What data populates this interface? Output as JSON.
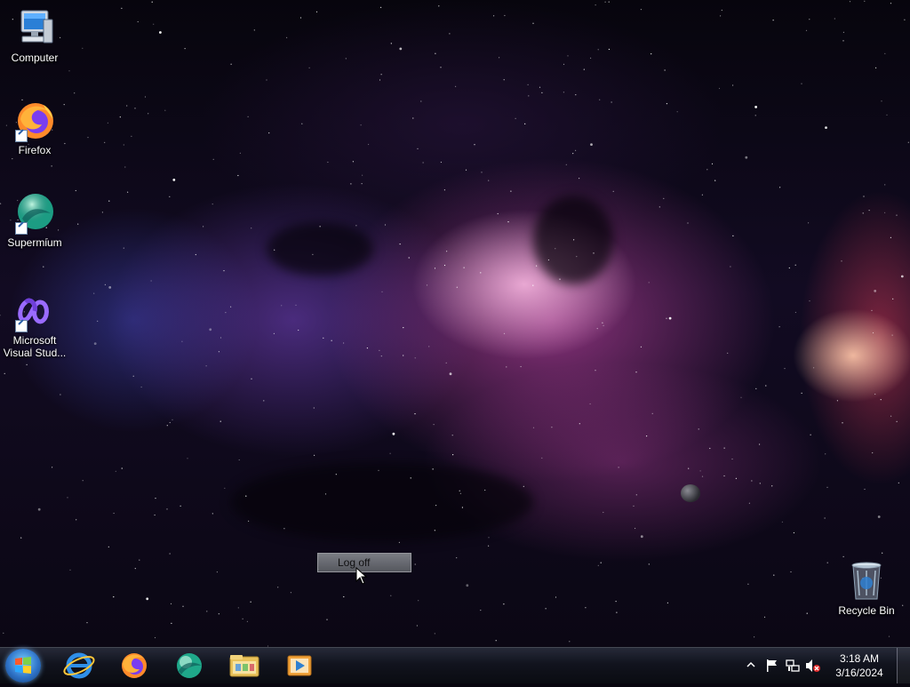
{
  "desktop": {
    "icons": [
      {
        "label": "Computer"
      },
      {
        "label": "Firefox"
      },
      {
        "label": "Supermium"
      },
      {
        "label": "Microsoft Visual Stud..."
      },
      {
        "label": "Recycle Bin"
      }
    ]
  },
  "tooltip": {
    "text": "Log off"
  },
  "taskbar": {
    "pinned": [
      {
        "name": "internet-explorer-icon"
      },
      {
        "name": "firefox-icon"
      },
      {
        "name": "supermium-icon"
      },
      {
        "name": "file-explorer-icon"
      },
      {
        "name": "media-player-icon"
      }
    ],
    "tray": {
      "icons": [
        "show-hidden-icons-chevron",
        "action-center-flag-icon",
        "network-icon",
        "volume-muted-icon"
      ]
    },
    "clock": {
      "time": "3:18 AM",
      "date": "3/16/2024"
    }
  },
  "colors": {
    "accent": "#2f74c9",
    "taskbar": "#12141e"
  }
}
